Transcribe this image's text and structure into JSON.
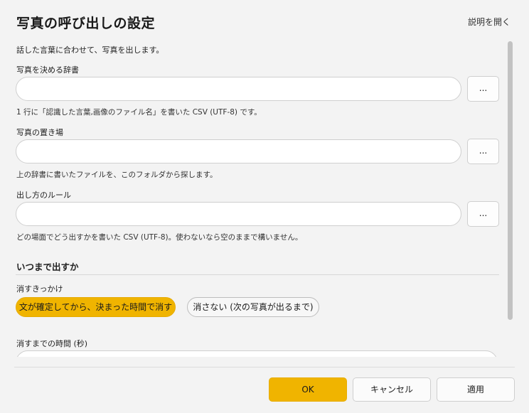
{
  "dialog": {
    "title": "写真の呼び出しの設定",
    "help_link": "説明を開く",
    "intro": "話した言葉に合わせて、写真を出します。"
  },
  "fields": [
    {
      "label": "写真を決める辞書",
      "value": "",
      "browse_label": "...",
      "hint": "1 行に「認識した言葉,画像のファイル名」を書いた CSV (UTF-8) です。"
    },
    {
      "label": "写真の置き場",
      "value": "",
      "browse_label": "...",
      "hint": "上の辞書に書いたファイルを、このフォルダから探します。"
    },
    {
      "label": "出し方のルール",
      "value": "",
      "browse_label": "...",
      "hint": "どの場面でどう出すかを書いた CSV (UTF-8)。使わないなら空のままで構いません。"
    }
  ],
  "duration_section": {
    "heading": "いつまで出すか",
    "trigger_label": "消すきっかけ",
    "options": [
      {
        "label": "文が確定してから、決まった時間で消す",
        "selected": true
      },
      {
        "label": "消さない (次の写真が出るまで)",
        "selected": false
      }
    ],
    "time_label": "消すまでの時間 (秒)"
  },
  "footer": {
    "ok_label": "OK",
    "cancel_label": "キャンセル",
    "apply_label": "適用"
  },
  "colors": {
    "accent": "#f0b400",
    "background": "#f3f3f3"
  }
}
